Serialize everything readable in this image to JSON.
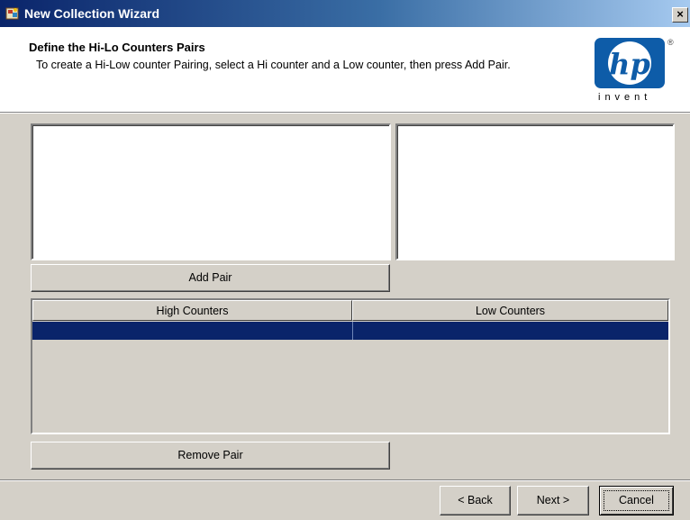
{
  "window": {
    "title": "New Collection Wizard",
    "close_glyph": "×",
    "icon": "app-icon"
  },
  "header": {
    "title": "Define the Hi-Lo Counters Pairs",
    "description": "To create a Hi-Low counter Pairing, select a Hi counter and a Low counter, then press Add Pair.",
    "logo": {
      "mark": "hp",
      "registered": "®",
      "tagline": "invent"
    }
  },
  "lists": {
    "high_counters": [],
    "low_counters": []
  },
  "add_pair_label": "Add Pair",
  "pairs_table": {
    "columns": [
      "High Counters",
      "Low Counters"
    ],
    "rows": [
      [
        "",
        ""
      ]
    ],
    "selected_row": 0
  },
  "remove_pair_label": "Remove Pair",
  "footer": {
    "back_label": "< Back",
    "next_label": "Next >",
    "cancel_label": "Cancel"
  },
  "colors": {
    "title_bar_start": "#0a246a",
    "title_bar_end": "#a6caf0",
    "selection": "#0a246a",
    "logo_blue": "#0e5ca8",
    "dialog_face": "#d4d0c8"
  }
}
